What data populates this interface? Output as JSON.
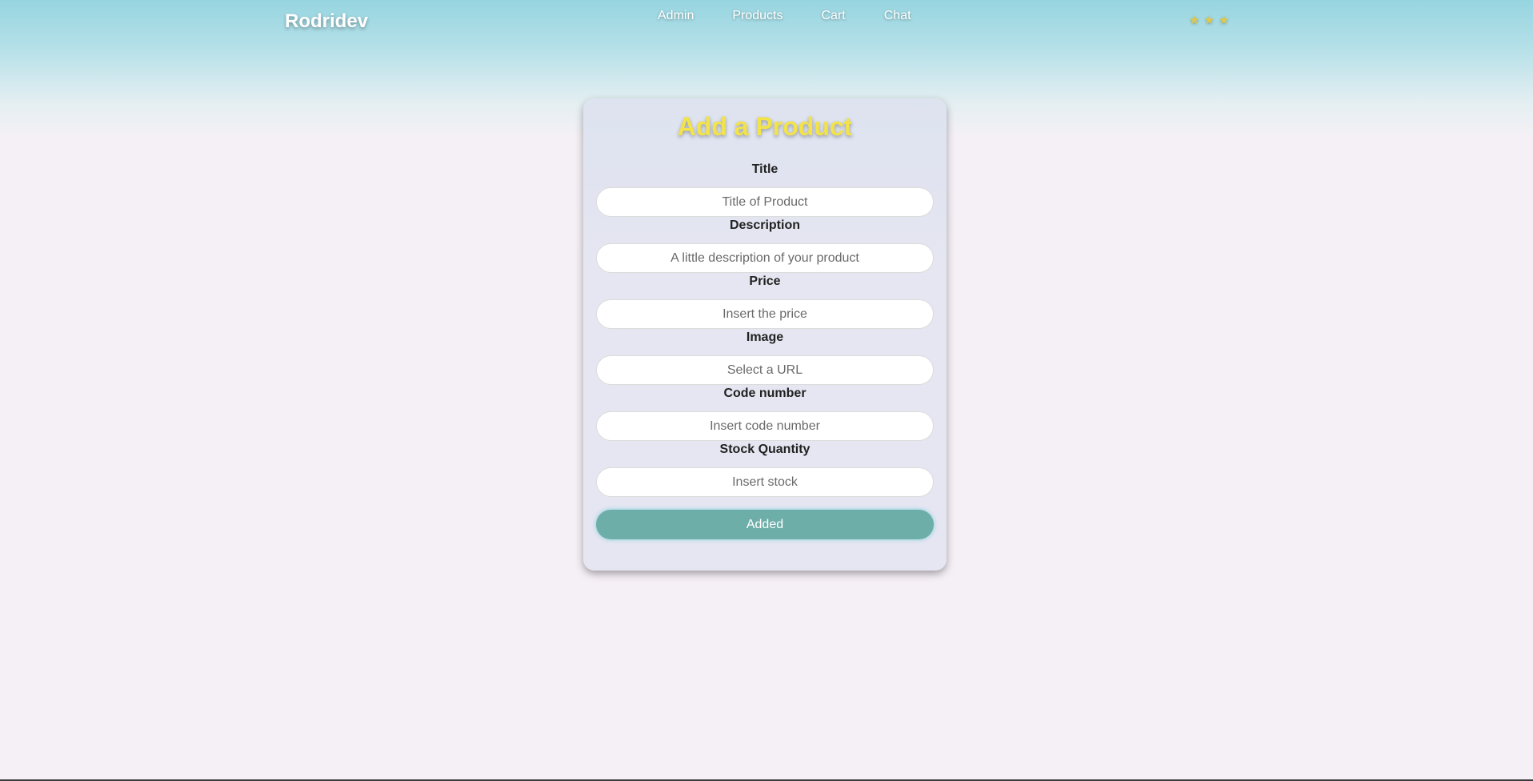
{
  "navbar": {
    "brand": "Rodridev",
    "links": [
      {
        "label": "Admin"
      },
      {
        "label": "Products"
      },
      {
        "label": "Cart"
      },
      {
        "label": "Chat"
      }
    ],
    "stars": [
      "★",
      "★",
      "★"
    ],
    "star_color": "#e2c84a"
  },
  "form": {
    "title": "Add a Product",
    "title_color": "#f2e34a",
    "fields": [
      {
        "label": "Title",
        "placeholder": "Title of Product"
      },
      {
        "label": "Description",
        "placeholder": "A little description of your product"
      },
      {
        "label": "Price",
        "placeholder": "Insert the price"
      },
      {
        "label": "Image",
        "placeholder": "Select a URL"
      },
      {
        "label": "Code number",
        "placeholder": "Insert code number"
      },
      {
        "label": "Stock Quantity",
        "placeholder": "Insert stock"
      }
    ],
    "submit_label": "Added",
    "submit_color": "#6eaea9"
  }
}
